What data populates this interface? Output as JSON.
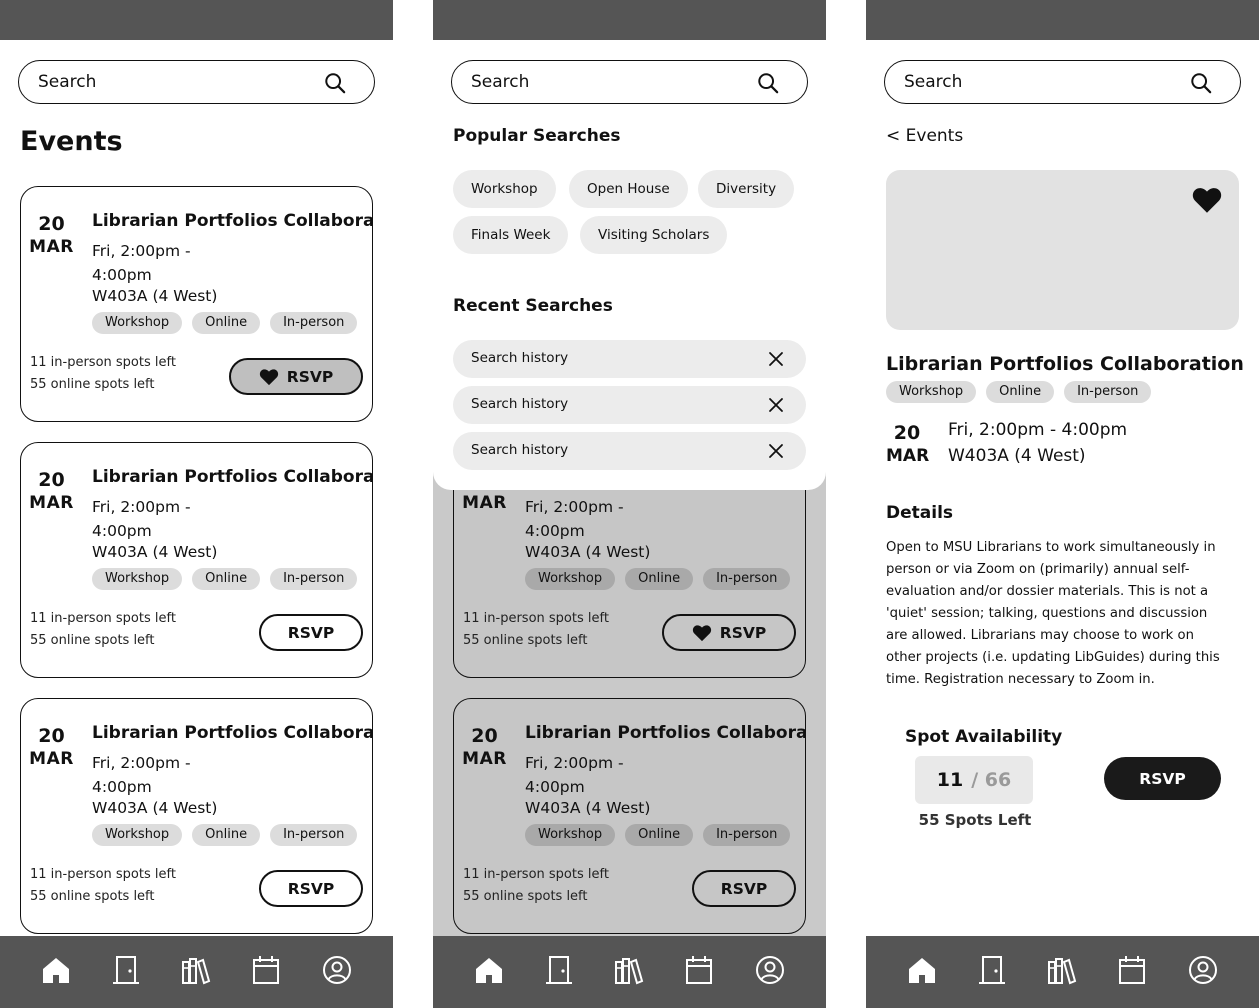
{
  "search": {
    "placeholder": "Search"
  },
  "events_list": {
    "title": "Events",
    "cards": [
      {
        "day": "20",
        "month": "MAR",
        "title": "Librarian Portfolios Collaboration",
        "time": "Fri, 2:00pm - 4:00pm",
        "room": "W403A (4 West)",
        "tags": [
          "Workshop",
          "Online",
          "In-person"
        ],
        "inperson_spots": "11 in-person spots left",
        "online_spots": "55 online spots left",
        "rsvp_label": "RSVP",
        "rsvp_state": "rsvped"
      },
      {
        "day": "20",
        "month": "MAR",
        "title": "Librarian Portfolios Collaboration",
        "time": "Fri, 2:00pm - 4:00pm",
        "room": "W403A (4 West)",
        "tags": [
          "Workshop",
          "Online",
          "In-person"
        ],
        "inperson_spots": "11 in-person spots left",
        "online_spots": "55 online spots left",
        "rsvp_label": "RSVP",
        "rsvp_state": "default"
      },
      {
        "day": "20",
        "month": "MAR",
        "title": "Librarian Portfolios Collaboration",
        "time": "Fri, 2:00pm - 4:00pm",
        "room": "W403A (4 West)",
        "tags": [
          "Workshop",
          "Online",
          "In-person"
        ],
        "inperson_spots": "11 in-person spots left",
        "online_spots": "55 online spots left",
        "rsvp_label": "RSVP",
        "rsvp_state": "default"
      }
    ]
  },
  "search_overlay": {
    "popular_title": "Popular Searches",
    "popular": [
      "Workshop",
      "Open House",
      "Diversity",
      "Finals Week",
      "Visiting Scholars"
    ],
    "recent_title": "Recent Searches",
    "recent": [
      "Search history",
      "Search history",
      "Search history"
    ],
    "bg_cards": [
      {
        "month": "MAR",
        "time": "Fri, 2:00pm - 4:00pm",
        "room": "W403A (4 West)",
        "tags": [
          "Workshop",
          "Online",
          "In-person"
        ],
        "inperson_spots": "11 in-person spots left",
        "online_spots": "55 online spots left",
        "rsvp_label": "RSVP"
      },
      {
        "day": "20",
        "month": "MAR",
        "title": "Librarian Portfolios Collaboration",
        "time": "Fri, 2:00pm - 4:00pm",
        "room": "W403A (4 West)",
        "tags": [
          "Workshop",
          "Online",
          "In-person"
        ],
        "inperson_spots": "11 in-person spots left",
        "online_spots": "55 online spots left",
        "rsvp_label": "RSVP"
      }
    ]
  },
  "detail": {
    "back_label": "< Events",
    "title": "Librarian Portfolios Collaboration",
    "tags": [
      "Workshop",
      "Online",
      "In-person"
    ],
    "day": "20",
    "month": "MAR",
    "time": "Fri, 2:00pm - 4:00pm",
    "room": "W403A (4 West)",
    "details_heading": "Details",
    "description": "Open to MSU Librarians to work simultaneously in person or via Zoom on (primarily) annual self-evaluation and/or dossier materials. This is not a 'quiet' session; talking, questions and discussion are allowed. Librarians may choose to work on other projects (i.e. updating LibGuides) during this time. Registration necessary to Zoom in.",
    "availability_title": "Spot Availability",
    "spots_taken": "11",
    "spots_total": "/ 66",
    "spots_left": "55 Spots Left",
    "rsvp_label": "RSVP"
  },
  "tabbar": {
    "icons": [
      "home-icon",
      "door-icon",
      "books-icon",
      "calendar-icon",
      "profile-icon"
    ]
  },
  "colors": {
    "chrome": "#555555",
    "chip": "#ececec",
    "tag": "#dcdcdc",
    "overlay": "#c9c9c9",
    "primary": "#1a1a1a"
  }
}
